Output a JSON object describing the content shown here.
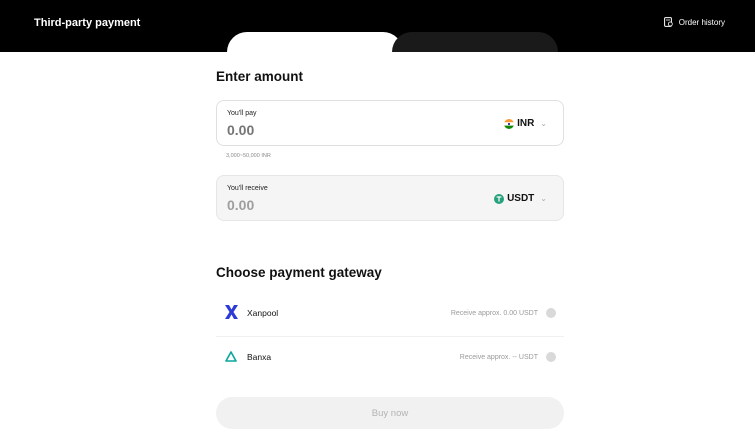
{
  "header": {
    "title": "Third-party payment",
    "order_history_label": "Order history"
  },
  "enter_amount": {
    "title": "Enter amount",
    "pay": {
      "label": "You'll pay",
      "value": "0.00",
      "currency": "INR",
      "range_hint": "3,000~50,000 INR"
    },
    "receive": {
      "label": "You'll receive",
      "value": "0.00",
      "currency": "USDT"
    }
  },
  "gateway": {
    "title": "Choose payment gateway",
    "options": [
      {
        "name": "Xanpool",
        "approx": "Receive approx. 0.00 USDT",
        "icon": "xanpool-logo-icon"
      },
      {
        "name": "Banxa",
        "approx": "Receive approx. -- USDT",
        "icon": "banxa-logo-icon"
      }
    ]
  },
  "buy_now_label": "Buy now",
  "colors": {
    "header_bg": "#000000",
    "xanpool_blue": "#2d3ad8",
    "banxa_teal": "#0aa59d",
    "usdt_green": "#26a17b",
    "disabled_button_bg": "#f1f1f1"
  }
}
